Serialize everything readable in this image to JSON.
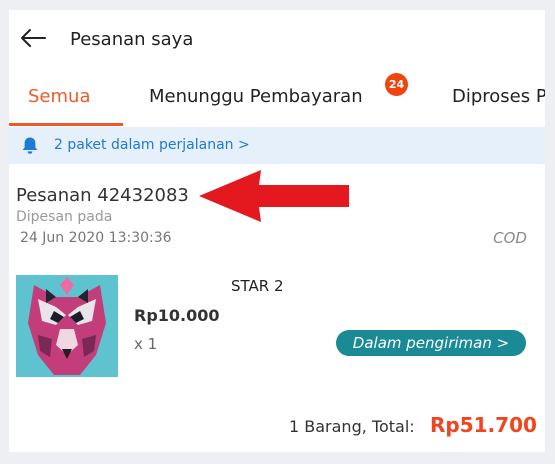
{
  "header": {
    "title": "Pesanan saya",
    "back_icon": "back-arrow-icon"
  },
  "tabs": [
    {
      "label": "Semua",
      "active": true
    },
    {
      "label": "Menunggu Pembayaran",
      "badge": "24"
    },
    {
      "label": "Diproses P"
    }
  ],
  "notice": {
    "icon": "bell-icon",
    "text": "2 paket dalam perjalanan >"
  },
  "order": {
    "id": "Pesanan 42432083",
    "ordered_label": "Dipesan pada",
    "date": "24 Jun 2020  13:30:36",
    "payment_method": "COD",
    "item": {
      "name": "STAR 2",
      "price": "Rp10.000",
      "quantity": "x 1",
      "status": "Dalam pengiriman >"
    },
    "summary_label": "1 Barang, Total:",
    "total": "Rp51.700"
  },
  "colors": {
    "accent": "#f05a28",
    "badge": "#f0450f",
    "notice_text": "#1f7ad1",
    "status_pill": "#1a8a96",
    "total": "#f0451f",
    "annotation_arrow": "#e3191f"
  }
}
